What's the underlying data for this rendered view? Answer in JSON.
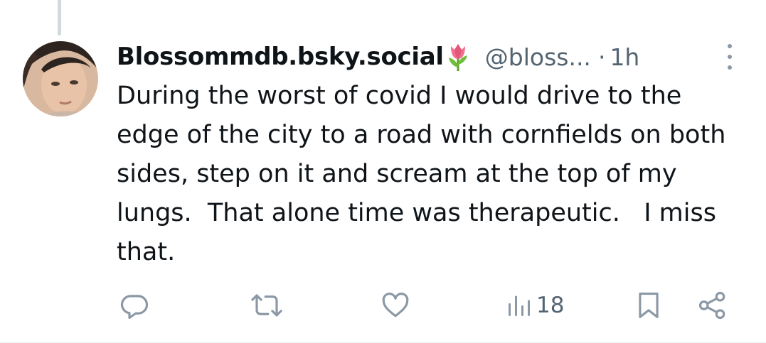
{
  "post": {
    "display_name": "Blossommdb.bsky.social",
    "handle": "@bloss...",
    "separator": "·",
    "time": "1h",
    "text": "During the worst of covid I would drive to the edge of the city to a road with cornfields on both sides, step on it and scream at the top of my lungs.  That alone time was therapeutic.   I miss that."
  },
  "actions": {
    "views_count": "18"
  },
  "colors": {
    "secondary_text": "#536471",
    "primary_text": "#0f1419",
    "thread_line": "#cfd9de"
  },
  "icons": [
    "reply-icon",
    "repost-icon",
    "like-icon",
    "views-icon",
    "bookmark-icon",
    "share-icon",
    "more-options-icon",
    "tulip-emoji-icon"
  ]
}
